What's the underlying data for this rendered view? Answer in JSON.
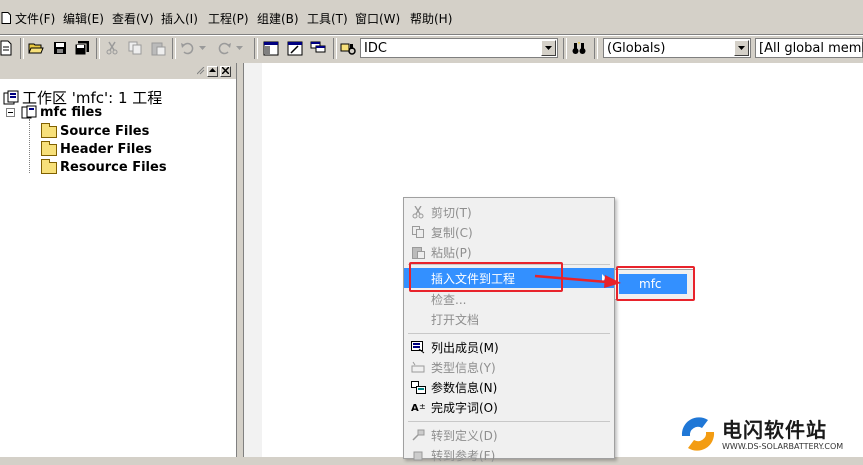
{
  "menubar": {
    "items": [
      "文件(F)",
      "编辑(E)",
      "查看(V)",
      "插入(I)",
      "工程(P)",
      "组建(B)",
      "工具(T)",
      "窗口(W)",
      "帮助(H)"
    ]
  },
  "toolbar": {
    "find_combo_value": "IDC",
    "class_combo_value": "(Globals)",
    "members_combo_value": "[All global memb"
  },
  "workspace": {
    "title": "工作区 'mfc': 1 工程",
    "project": "mfc files",
    "folders": [
      "Source Files",
      "Header Files",
      "Resource Files"
    ]
  },
  "context_menu": {
    "items": [
      {
        "label": "剪切(T)",
        "icon": "scissors-icon",
        "disabled": true
      },
      {
        "label": "复制(C)",
        "icon": "copy-icon",
        "disabled": true
      },
      {
        "label": "粘贴(P)",
        "icon": "paste-icon",
        "disabled": true
      },
      {
        "label": "插入文件到工程",
        "icon": "",
        "disabled": false,
        "highlighted": true,
        "submenu": true
      },
      {
        "label": "检查...",
        "icon": "",
        "disabled": true
      },
      {
        "label": "打开文档",
        "icon": "",
        "disabled": true
      },
      {
        "label": "列出成员(M)",
        "icon": "list-members-icon",
        "disabled": false
      },
      {
        "label": "类型信息(Y)",
        "icon": "type-info-icon",
        "disabled": true
      },
      {
        "label": "参数信息(N)",
        "icon": "param-info-icon",
        "disabled": false
      },
      {
        "label": "完成字词(O)",
        "icon": "complete-word-icon",
        "disabled": false
      },
      {
        "label": "转到定义(D)",
        "icon": "goto-def-icon",
        "disabled": true
      },
      {
        "label": "转到参考(F)",
        "icon": "goto-ref-icon",
        "disabled": true
      }
    ]
  },
  "submenu": {
    "item": "mfc"
  },
  "watermark": {
    "text": "电闪软件站",
    "sub": "WWW.DS-SOLARBATTERY.COM"
  },
  "colors": {
    "highlight": "#3390ff",
    "annotation": "#e8232b",
    "chrome": "#d4d0c8"
  }
}
